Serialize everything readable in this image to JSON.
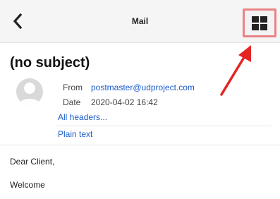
{
  "header": {
    "title": "Mail",
    "back_icon": "chevron-left-icon",
    "layout_icon": "grid-view-icon"
  },
  "message": {
    "subject": "(no subject)",
    "from_label": "From",
    "from_value": "postmaster@udproject.com",
    "date_label": "Date",
    "date_value": "2020-04-02 16:42",
    "all_headers": "All headers...",
    "plain_text": "Plain text"
  },
  "body": {
    "greeting": "Dear Client,",
    "line1": "Welcome"
  },
  "colors": {
    "link": "#1a5bc9",
    "highlight": "#e98386",
    "arrow": "#e52424"
  }
}
